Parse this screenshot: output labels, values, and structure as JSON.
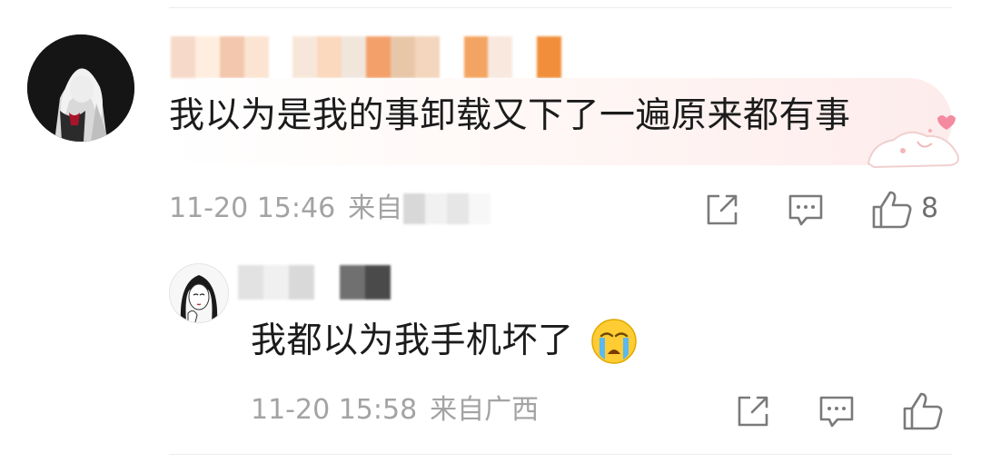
{
  "comments": {
    "main": {
      "username": "",
      "text": "我以为是我的事卸载又下了一遍原来都有事",
      "timestamp": "11-20 15:46",
      "source_prefix": "来自",
      "likes": "8",
      "avatar_icon": "anime-character-avatar"
    },
    "reply": {
      "username": "",
      "text": "我都以为我手机坏了",
      "emoji_icon": "crying-face-emoji",
      "timestamp": "11-20 15:58",
      "source": "来自广西",
      "avatar_icon": "sketch-girl-avatar"
    }
  },
  "actions": {
    "share_icon": "share-icon",
    "comment_icon": "comment-icon",
    "like_icon": "thumbs-up-icon"
  },
  "colors": {
    "text": "#1b1b1b",
    "meta": "#a3a3a3",
    "icon": "#7a7a7a",
    "bubble_pink": "#fdecec"
  }
}
